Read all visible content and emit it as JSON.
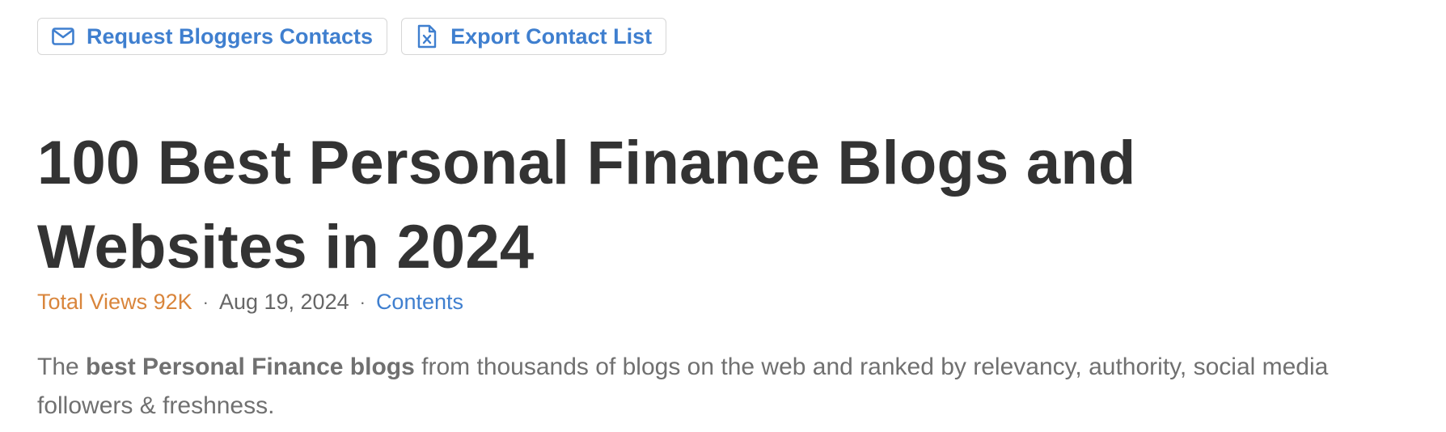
{
  "toolbar": {
    "request_button": {
      "label": "Request Bloggers Contacts",
      "icon": "envelope-icon"
    },
    "export_button": {
      "label": "Export Contact List",
      "icon": "excel-file-icon"
    }
  },
  "article": {
    "title_line1": "100 Best Personal Finance Blogs and",
    "title_line2": "Websites in 2024",
    "meta": {
      "views_label": "Total Views 92K",
      "separator": "·",
      "date": "Aug 19, 2024",
      "contents_link": "Contents"
    },
    "intro": {
      "prefix": "The ",
      "bold": "best Personal Finance blogs",
      "suffix": " from thousands of blogs on the web and ranked by relevancy, authority, social media followers & freshness."
    }
  },
  "colors": {
    "accent": "#3f7fcf",
    "views": "#d9853b",
    "title": "#333333",
    "body_text": "#707070",
    "border": "#d6d6d6"
  }
}
